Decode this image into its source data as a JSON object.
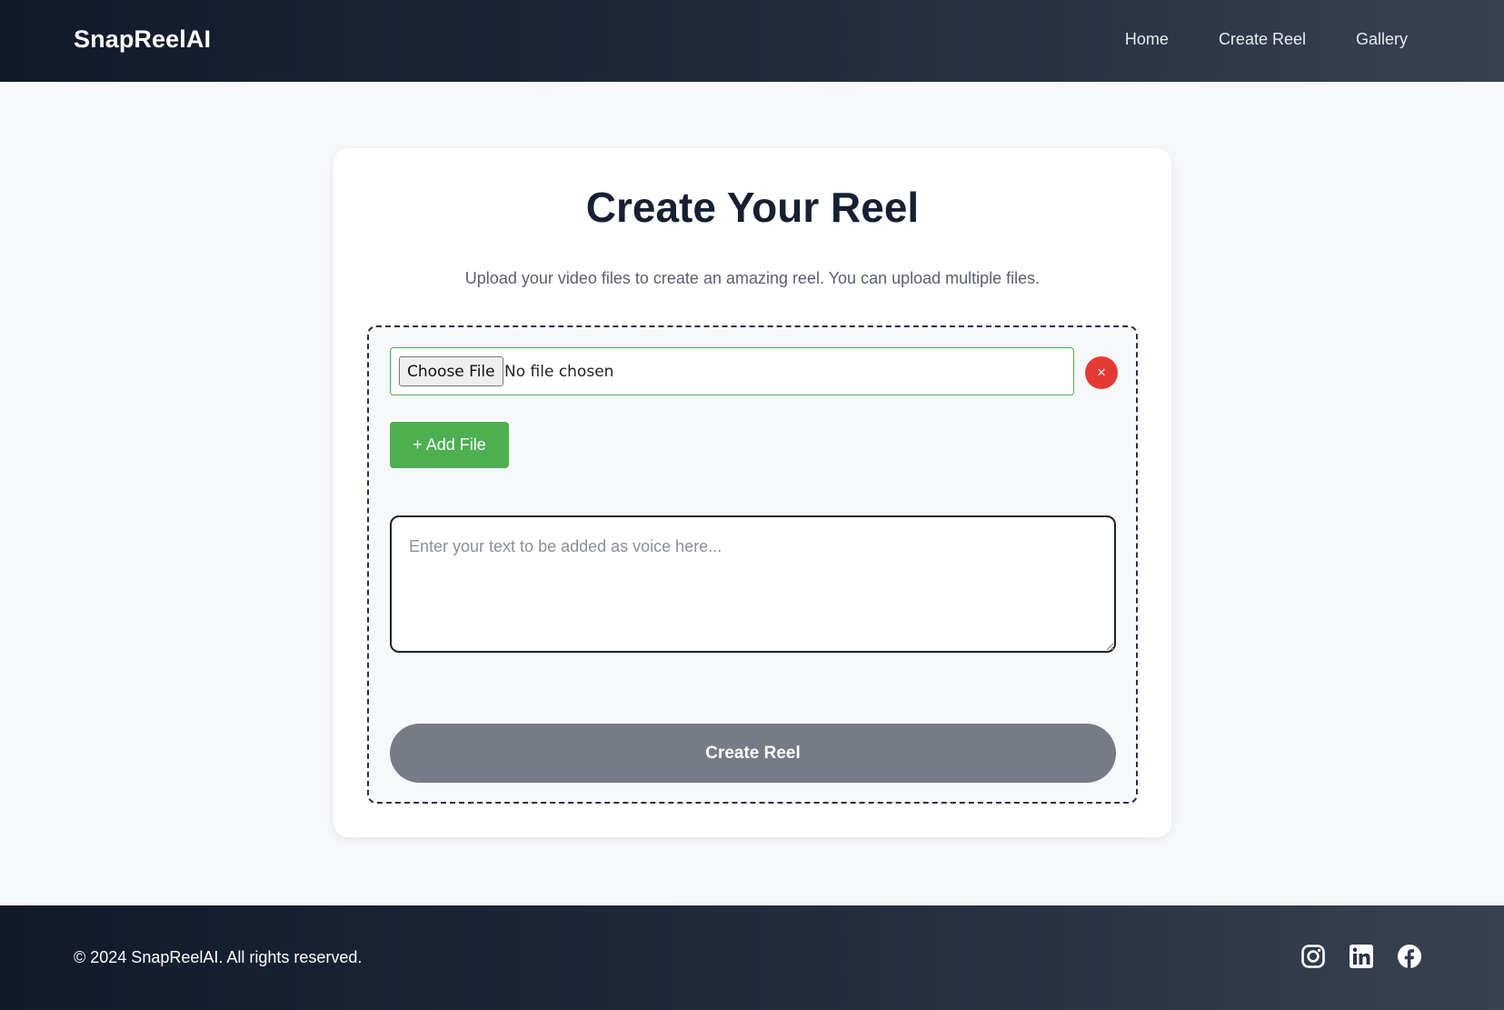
{
  "header": {
    "brand": "SnapReelAI",
    "nav": [
      "Home",
      "Create Reel",
      "Gallery"
    ]
  },
  "card": {
    "title": "Create Your Reel",
    "subtitle": "Upload your video files to create an amazing reel. You can upload multiple files."
  },
  "upload": {
    "choose_label": "Choose File",
    "file_status": "No file chosen",
    "remove_label": "×",
    "add_label": "+ Add File"
  },
  "voice": {
    "value": "",
    "placeholder": "Enter your text to be added as voice here..."
  },
  "submit": {
    "label": "Create Reel"
  },
  "footer": {
    "copyright": "© 2024 SnapReelAI. All rights reserved.",
    "social_icons": [
      "instagram-icon",
      "linkedin-icon",
      "facebook-icon"
    ]
  },
  "colors": {
    "header_start": "#111a2b",
    "header_end": "#394152",
    "accent_green": "#4caf50",
    "remove_red": "#e53935",
    "submit_gray": "#777b86",
    "page_background": "#f7f8fa"
  }
}
